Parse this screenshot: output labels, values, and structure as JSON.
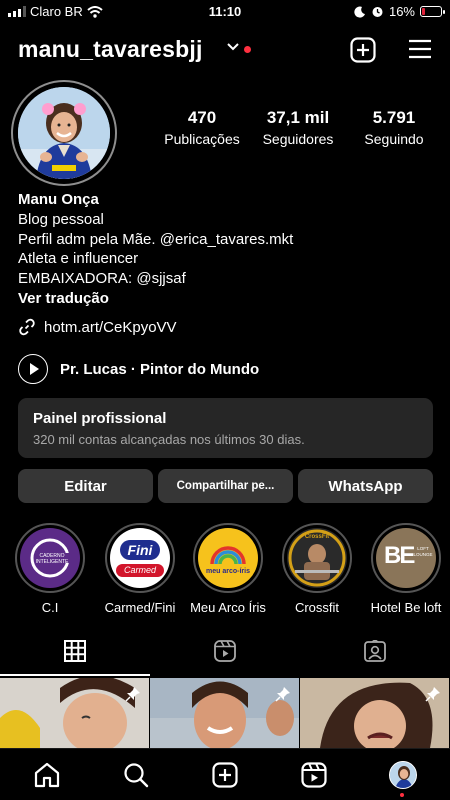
{
  "status_bar": {
    "carrier": "Claro BR",
    "time": "11:10",
    "battery": "16%"
  },
  "header": {
    "username": "manu_tavaresbjj"
  },
  "stats": [
    {
      "num": "470",
      "label": "Publicações"
    },
    {
      "num": "37,1 mil",
      "label": "Seguidores"
    },
    {
      "num": "5.791",
      "label": "Seguindo"
    }
  ],
  "bio": {
    "name": "Manu Onça",
    "category": "Blog pessoal",
    "line1": "Perfil adm pela Mãe. @erica_tavares.mkt",
    "line2": "Atleta e influencer",
    "line3": "EMBAIXADORA: @sjjsaf",
    "translate": "Ver tradução"
  },
  "link": "hotm.art/CeKpyoVV",
  "music": "Pr. Lucas · Pintor do Mundo",
  "panel": {
    "title": "Painel profissional",
    "subtitle": "320 mil contas alcançadas nos últimos 30 dias."
  },
  "buttons": {
    "edit": "Editar",
    "share": "Compartilhar pe...",
    "whatsapp": "WhatsApp"
  },
  "highlights": [
    {
      "label": "C.I",
      "inner": "CADERNO INTELIGENTE"
    },
    {
      "label": "Carmed/Fini",
      "inner": "Fini",
      "inner2": "Carmed"
    },
    {
      "label": "Meu Arco Íris",
      "inner": "meu arco-íris"
    },
    {
      "label": "Crossfit",
      "inner": "CrossFit"
    },
    {
      "label": "Hotel Be loft",
      "inner": "BE",
      "inner2": "LOFT LOUNGE"
    }
  ],
  "tabs": [
    "posts",
    "reels",
    "tagged"
  ],
  "colors": {
    "background": "#000000",
    "accent_red": "#ff3040",
    "button_bg": "#363636",
    "panel_bg": "#262626"
  }
}
